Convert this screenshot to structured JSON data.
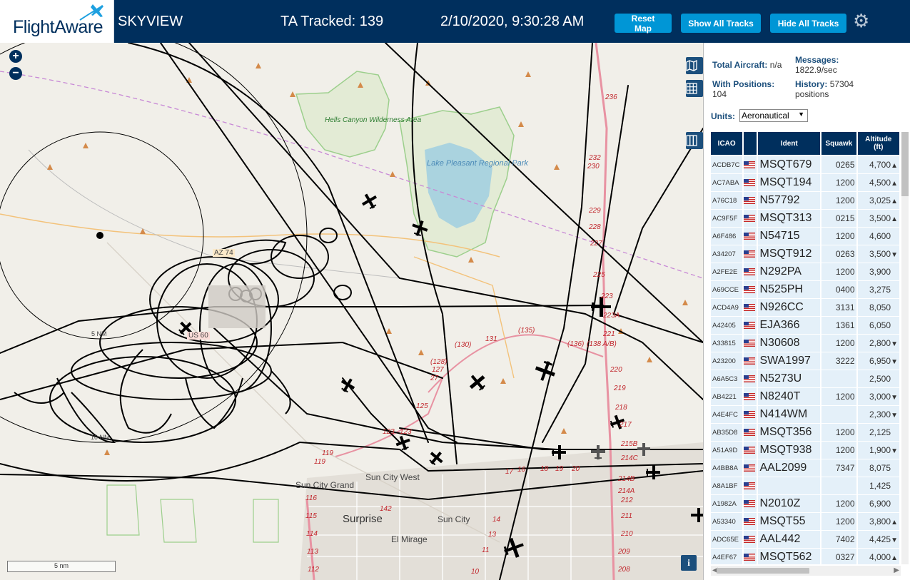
{
  "header": {
    "logo_text": "FlightAware",
    "app_title": "SKYVIEW",
    "tracked": "TA Tracked: 139",
    "datetime": "2/10/2020, 9:30:28 AM",
    "buttons": {
      "reset_map": "Reset Map",
      "show_all_tracks": "Show All Tracks",
      "hide_all_tracks": "Hide All Tracks"
    },
    "gear_icon": "gear-icon"
  },
  "map": {
    "zoom_in": "+",
    "zoom_out": "−",
    "scale_label": "5 nm",
    "range_labels": [
      "5 NM",
      "10 NM"
    ],
    "labels": {
      "hells_canyon": "Hells Canyon Wilderness Area",
      "lake_pleasant": "Lake Pleasant Regional Park",
      "sun_city_west": "Sun City West",
      "sun_city_grand": "Sun City Grand",
      "surprise": "Surprise",
      "sun_city": "Sun City",
      "el_mirage": "El Mirage",
      "az74": "AZ 74",
      "us60": "US 60"
    },
    "road_numbers": [
      "236",
      "232",
      "230",
      "229",
      "228",
      "227",
      "225",
      "223",
      "223A",
      "221",
      "220",
      "219",
      "218",
      "217",
      "215B",
      "214C",
      "214B",
      "214A",
      "212",
      "211",
      "210",
      "209",
      "208",
      "(135)",
      "131",
      "(130)",
      "(136)",
      "(138 A/B)",
      "(128)",
      "127",
      "27",
      "125",
      "123",
      "123",
      "119",
      "119",
      "116",
      "115",
      "114",
      "113",
      "112",
      "142",
      "17",
      "16",
      "18",
      "19",
      "20",
      "14",
      "13",
      "11",
      "10"
    ],
    "colors": {
      "land": "#f1efe9",
      "park": "#9ccf8c",
      "water": "#aad3df",
      "track": "#000000",
      "road": "#e892a2"
    }
  },
  "panel": {
    "total_aircraft_label": "Total Aircraft:",
    "total_aircraft_value": "n/a",
    "with_positions_label": "With Positions:",
    "with_positions_value": "104",
    "messages_label": "Messages:",
    "messages_value": "1822.9/sec",
    "history_label": "History:",
    "history_value": "57304 positions",
    "units_label": "Units:",
    "units_value": "Aeronautical",
    "columns": [
      "ICAO",
      "",
      "Ident",
      "Squawk",
      "Altitude (ft)"
    ],
    "rows": [
      {
        "icao": "ACDB7C",
        "ident": "MSQT679",
        "squawk": "0265",
        "alt": "4,700",
        "trend": "▲"
      },
      {
        "icao": "AC7ABA",
        "ident": "MSQT194",
        "squawk": "1200",
        "alt": "4,500",
        "trend": "▲"
      },
      {
        "icao": "A76C18",
        "ident": "N57792",
        "squawk": "1200",
        "alt": "3,025",
        "trend": "▲"
      },
      {
        "icao": "AC9F5F",
        "ident": "MSQT313",
        "squawk": "0215",
        "alt": "3,500",
        "trend": "▲"
      },
      {
        "icao": "A6F486",
        "ident": "N54715",
        "squawk": "1200",
        "alt": "4,600",
        "trend": ""
      },
      {
        "icao": "A34207",
        "ident": "MSQT912",
        "squawk": "0263",
        "alt": "3,500",
        "trend": "▼"
      },
      {
        "icao": "A2FE2E",
        "ident": "N292PA",
        "squawk": "1200",
        "alt": "3,900",
        "trend": ""
      },
      {
        "icao": "A69CCE",
        "ident": "N525PH",
        "squawk": "0400",
        "alt": "3,275",
        "trend": ""
      },
      {
        "icao": "ACD4A9",
        "ident": "N926CC",
        "squawk": "3131",
        "alt": "8,050",
        "trend": ""
      },
      {
        "icao": "A42405",
        "ident": "EJA366",
        "squawk": "1361",
        "alt": "6,050",
        "trend": ""
      },
      {
        "icao": "A33815",
        "ident": "N30608",
        "squawk": "1200",
        "alt": "2,800",
        "trend": "▼"
      },
      {
        "icao": "A23200",
        "ident": "SWA1997",
        "squawk": "3222",
        "alt": "6,950",
        "trend": "▼"
      },
      {
        "icao": "A6A5C3",
        "ident": "N5273U",
        "squawk": "",
        "alt": "2,500",
        "trend": ""
      },
      {
        "icao": "AB4221",
        "ident": "N8240T",
        "squawk": "1200",
        "alt": "3,000",
        "trend": "▼"
      },
      {
        "icao": "A4E4FC",
        "ident": "N414WM",
        "squawk": "",
        "alt": "2,300",
        "trend": "▼"
      },
      {
        "icao": "AB35D8",
        "ident": "MSQT356",
        "squawk": "1200",
        "alt": "2,125",
        "trend": ""
      },
      {
        "icao": "A51A9D",
        "ident": "MSQT938",
        "squawk": "1200",
        "alt": "1,900",
        "trend": "▼"
      },
      {
        "icao": "A4BB8A",
        "ident": "AAL2099",
        "squawk": "7347",
        "alt": "8,075",
        "trend": ""
      },
      {
        "icao": "A8A1BF",
        "ident": "",
        "squawk": "",
        "alt": "1,425",
        "trend": ""
      },
      {
        "icao": "A1982A",
        "ident": "N2010Z",
        "squawk": "1200",
        "alt": "6,900",
        "trend": ""
      },
      {
        "icao": "A53340",
        "ident": "MSQT55",
        "squawk": "1200",
        "alt": "3,800",
        "trend": "▲"
      },
      {
        "icao": "ADC65E",
        "ident": "AAL442",
        "squawk": "7402",
        "alt": "4,425",
        "trend": "▼"
      },
      {
        "icao": "A4EF67",
        "ident": "MSQT562",
        "squawk": "0327",
        "alt": "4,000",
        "trend": "▲"
      }
    ]
  }
}
